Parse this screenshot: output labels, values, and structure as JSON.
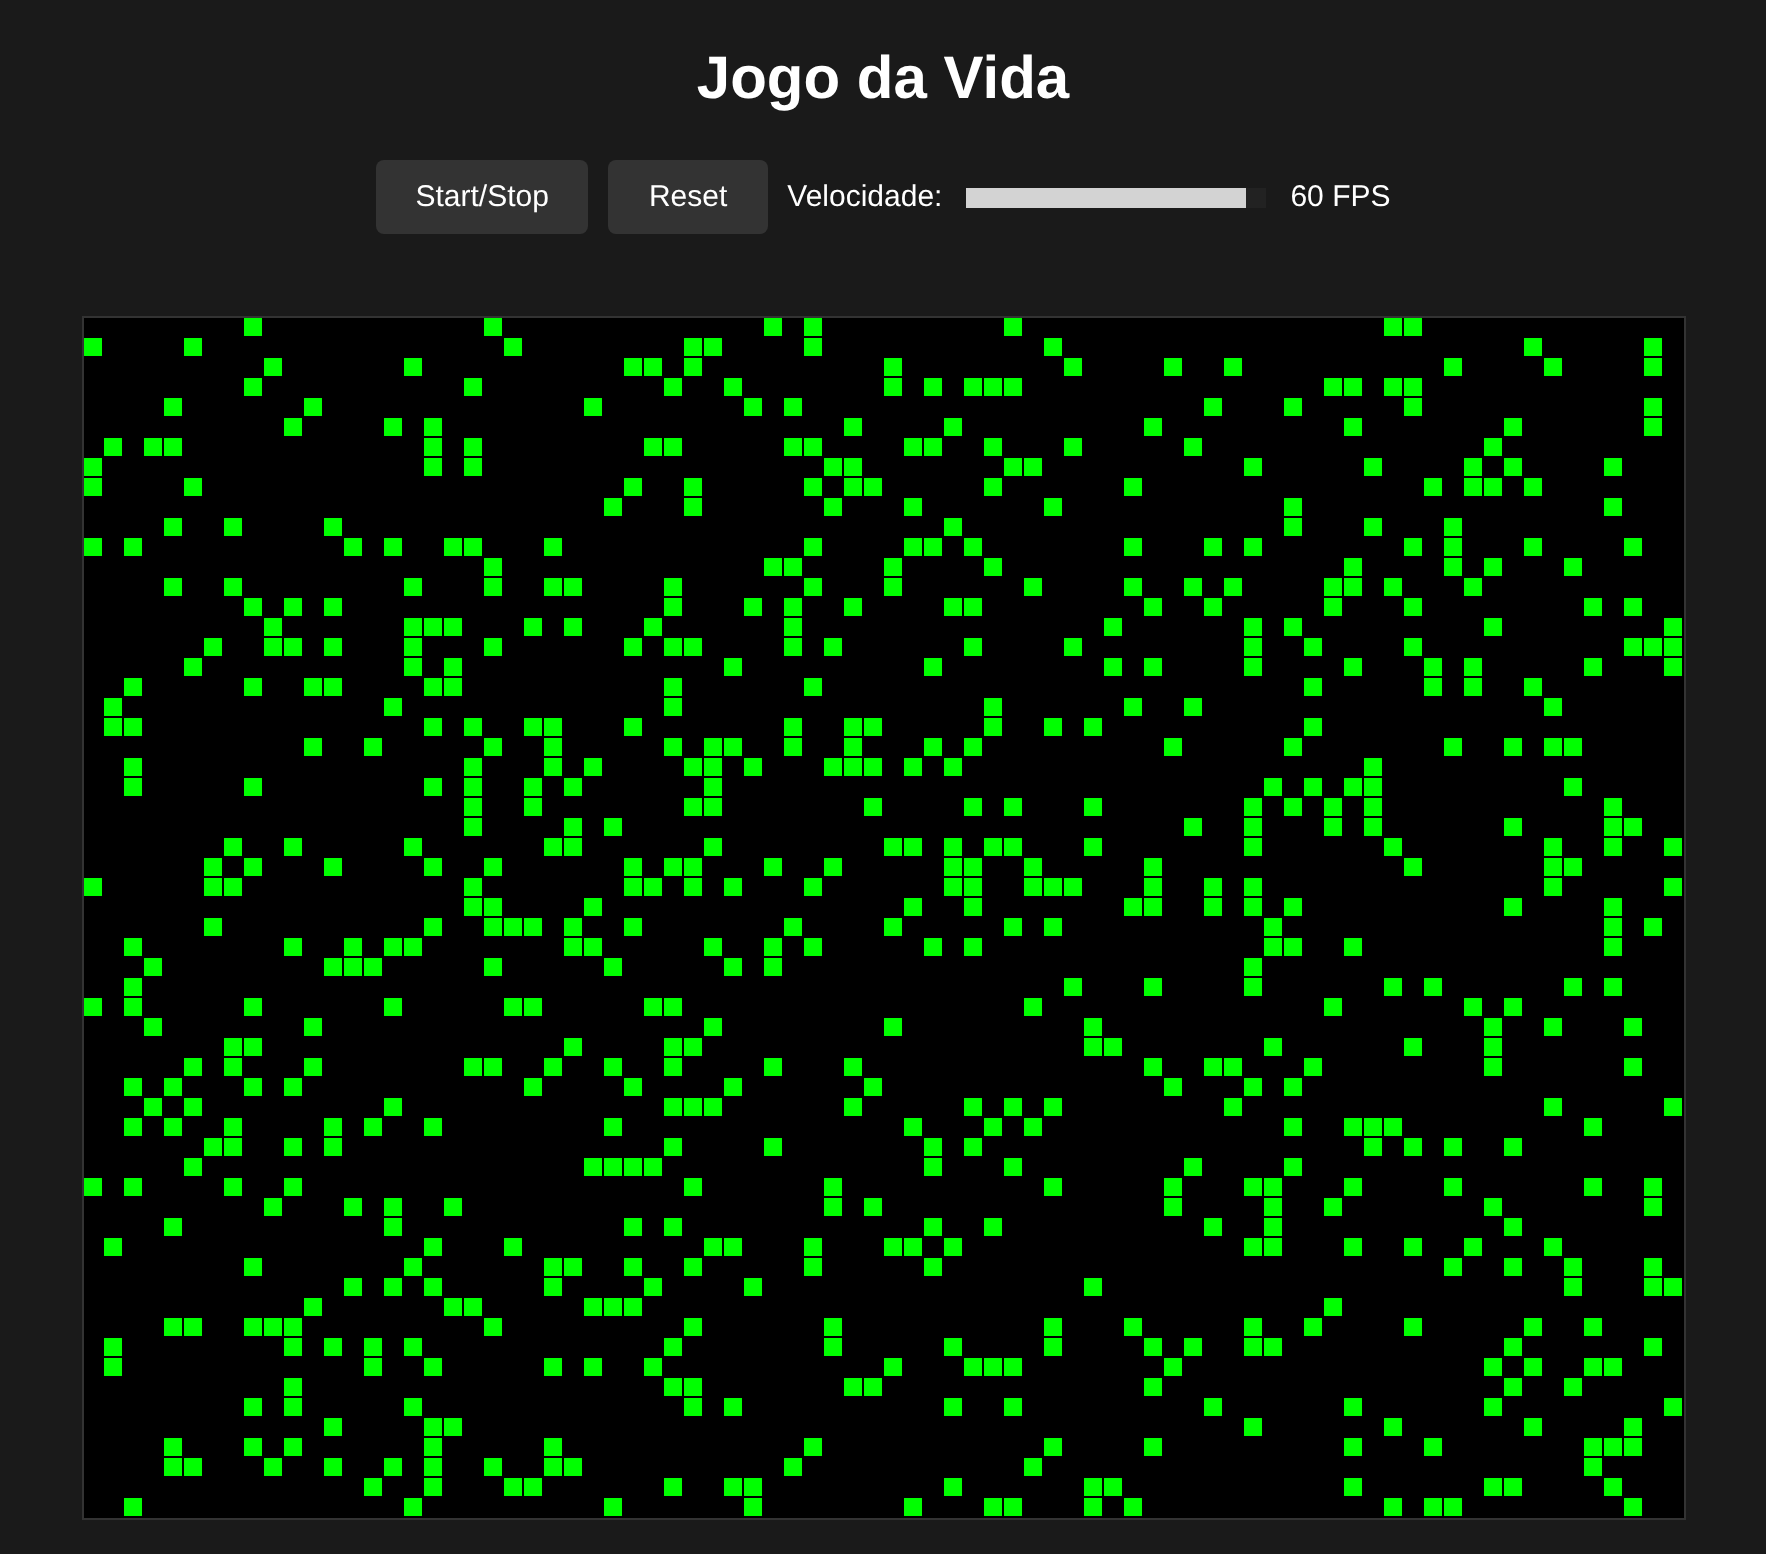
{
  "title": "Jogo da Vida",
  "controls": {
    "buttons": [
      {
        "label": "Start/Stop"
      },
      {
        "label": "Reset"
      }
    ],
    "speed": {
      "label": "Velocidade:",
      "level": 0.93,
      "reading": "60 FPS"
    }
  }
}
